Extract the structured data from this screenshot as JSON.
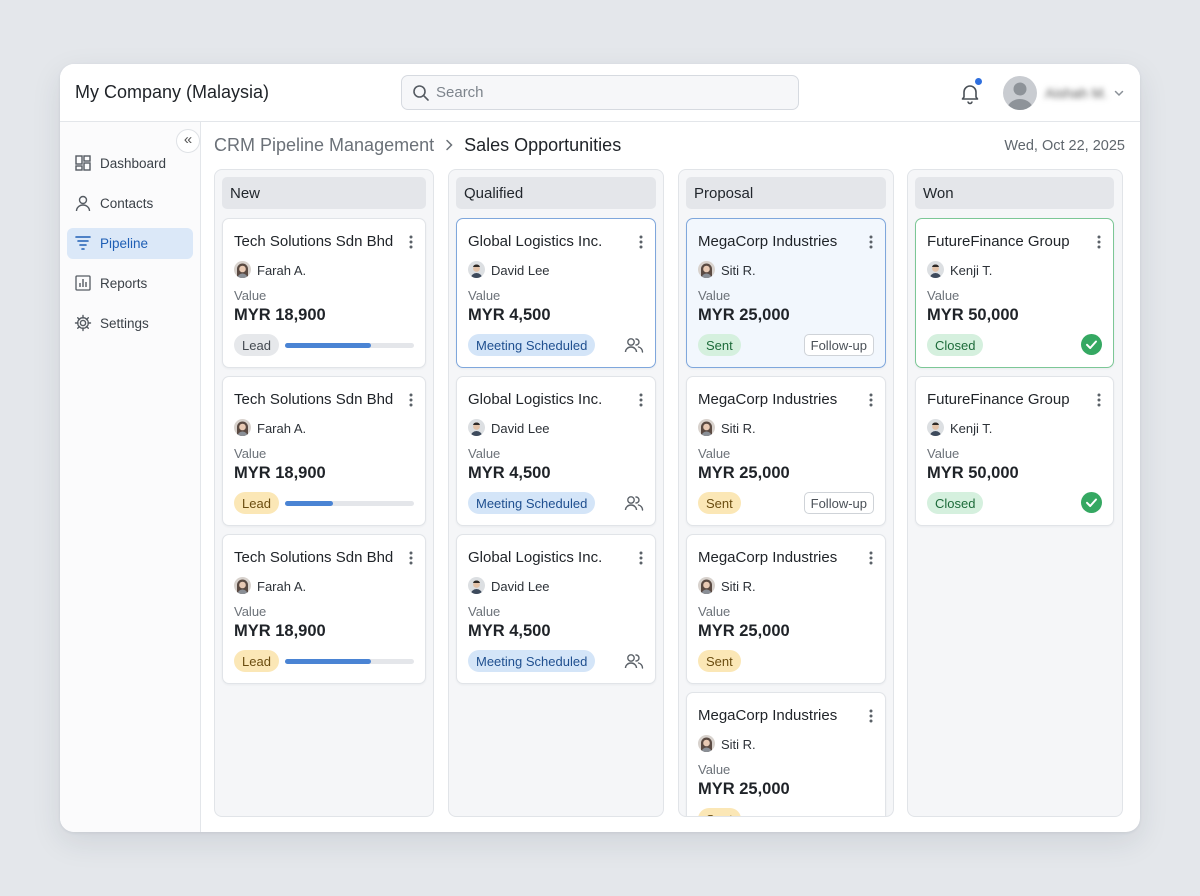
{
  "header": {
    "company": "My Company (Malaysia)",
    "search_placeholder": "Search",
    "user_name": "Aishah M."
  },
  "sidebar": {
    "items": [
      {
        "label": "Dashboard",
        "icon": "dashboard-icon",
        "active": false
      },
      {
        "label": "Contacts",
        "icon": "user-icon",
        "active": false
      },
      {
        "label": "Pipeline",
        "icon": "funnel-icon",
        "active": true
      },
      {
        "label": "Reports",
        "icon": "bar-chart-icon",
        "active": false
      },
      {
        "label": "Settings",
        "icon": "gear-icon",
        "active": false
      }
    ]
  },
  "breadcrumb": {
    "parent": "CRM Pipeline Management",
    "current": "Sales Opportunities"
  },
  "date": "Wed, Oct 22, 2025",
  "colors": {
    "accent": "#4a84d4",
    "active_nav": "#dbe8f8",
    "success": "#35a862",
    "badge_yellow": "#fbe7b6",
    "badge_blue": "#d4e5f8",
    "badge_green": "#d5f0de"
  },
  "columns": [
    {
      "name": "New",
      "cards": [
        {
          "title": "Tech Solutions Sdn Bhd",
          "owner": "Farah A.",
          "value_label": "Value",
          "value": "MYR 18,900",
          "badge": "Lead",
          "badge_style": "gray",
          "progress": 0.67
        },
        {
          "title": "Tech Solutions Sdn Bhd",
          "owner": "Farah A.",
          "value_label": "Value",
          "value": "MYR 18,900",
          "badge": "Lead",
          "badge_style": "yellow",
          "progress": 0.37
        },
        {
          "title": "Tech Solutions Sdn Bhd",
          "owner": "Farah A.",
          "value_label": "Value",
          "value": "MYR 18,900",
          "badge": "Lead",
          "badge_style": "yellow",
          "progress": 0.67
        }
      ]
    },
    {
      "name": "Qualified",
      "cards": [
        {
          "title": "Global Logistics Inc.",
          "owner": "David Lee",
          "value_label": "Value",
          "value": "MYR 4,500",
          "badge": "Meeting Scheduled",
          "badge_style": "blue"
        },
        {
          "title": "Global Logistics Inc.",
          "owner": "David Lee",
          "value_label": "Value",
          "value": "MYR 4,500",
          "badge": "Meeting Scheduled",
          "badge_style": "blue"
        },
        {
          "title": "Global Logistics Inc.",
          "owner": "David Lee",
          "value_label": "Value",
          "value": "MYR 4,500",
          "badge": "Meeting Scheduled",
          "badge_style": "blue"
        }
      ]
    },
    {
      "name": "Proposal",
      "cards": [
        {
          "title": "MegaCorp Industries",
          "owner": "Siti R.",
          "value_label": "Value",
          "value": "MYR 25,000",
          "badge": "Sent",
          "badge_style": "green",
          "tag": "Follow-up"
        },
        {
          "title": "MegaCorp Industries",
          "owner": "Siti R.",
          "value_label": "Value",
          "value": "MYR 25,000",
          "badge": "Sent",
          "badge_style": "yellow",
          "tag": "Follow-up"
        },
        {
          "title": "MegaCorp Industries",
          "owner": "Siti R.",
          "value_label": "Value",
          "value": "MYR 25,000",
          "badge": "Sent",
          "badge_style": "yellow"
        },
        {
          "title": "MegaCorp Industries",
          "owner": "Siti R.",
          "value_label": "Value",
          "value": "MYR 25,000",
          "badge": "Sent",
          "badge_style": "yellow"
        }
      ]
    },
    {
      "name": "Won",
      "cards": [
        {
          "title": "FutureFinance Group",
          "owner": "Kenji T.",
          "value_label": "Value",
          "value": "MYR 50,000",
          "badge": "Closed",
          "badge_style": "green"
        },
        {
          "title": "FutureFinance Group",
          "owner": "Kenji T.",
          "value_label": "Value",
          "value": "MYR 50,000",
          "badge": "Closed",
          "badge_style": "green"
        }
      ]
    }
  ]
}
